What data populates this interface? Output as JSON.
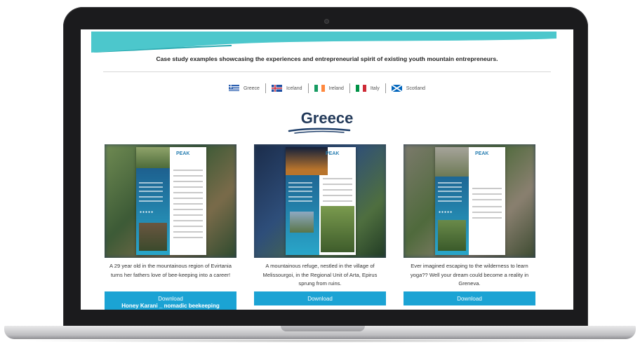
{
  "intro_text": "Case study examples showcasing the experiences and entrepreneurial spirit of existing youth mountain entrepreneurs.",
  "countries": [
    {
      "name": "Greece"
    },
    {
      "name": "Iceland"
    },
    {
      "name": "Ireland"
    },
    {
      "name": "Italy"
    },
    {
      "name": "Scotland"
    }
  ],
  "section_title": "Greece",
  "doc_logo_text": "PEAK",
  "cards": [
    {
      "description": "A 29 year old in the mountainous region of Evirtania turns her fathers love of bee-keeping into a career!",
      "button_label": "Download",
      "button_sub": "Honey Karani _ nomadic beekeeping"
    },
    {
      "description": "A mountainous refuge, nestled in the village of Melissourgoi, in the Regional Unit of Arta, Epirus sprung from ruins.",
      "button_label": "Download",
      "button_sub": ""
    },
    {
      "description": "Ever imagined escaping to the wilderness to learn yoga?? Well your dream could become a reality in Greneva.",
      "button_label": "Download",
      "button_sub": ""
    }
  ],
  "colors": {
    "accent": "#1ba3d4",
    "band": "#4cc7cc",
    "title": "#233a5a"
  }
}
